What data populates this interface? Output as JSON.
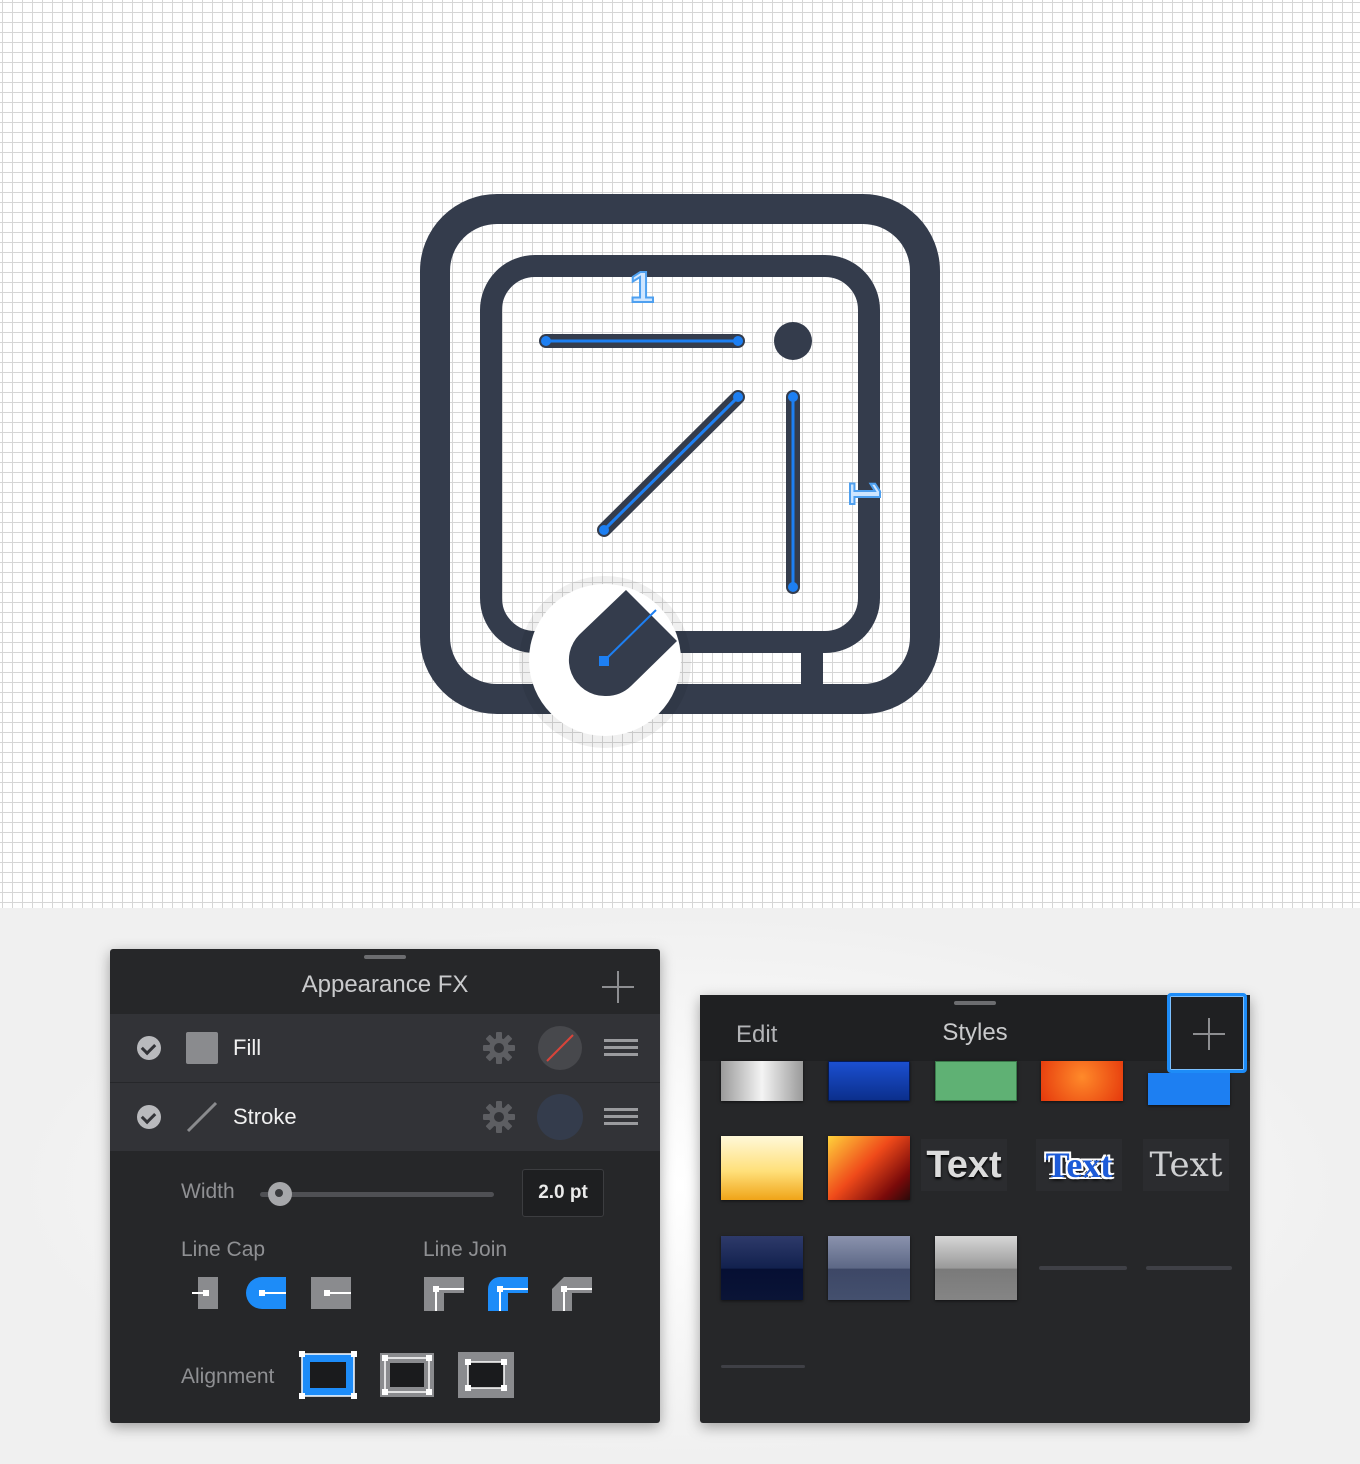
{
  "canvas": {
    "icon_color": "#343c4c",
    "path_highlight_color": "#1d7ff2",
    "measure_label_top": "1",
    "measure_label_side": "1"
  },
  "appearance_panel": {
    "title": "Appearance FX",
    "rows": [
      {
        "label": "Fill",
        "enabled": true,
        "swatch": "none"
      },
      {
        "label": "Stroke",
        "enabled": true,
        "swatch": "#343c4c"
      }
    ],
    "width_label": "Width",
    "width_value": "2.0 pt",
    "line_cap_label": "Line Cap",
    "line_join_label": "Line Join",
    "alignment_label": "Alignment",
    "line_cap_selected": "round",
    "line_join_selected": "round",
    "alignment_selected": "inside",
    "accent": "#1d8cf8"
  },
  "styles_panel": {
    "edit_label": "Edit",
    "title": "Styles",
    "text_styles": [
      "Text",
      "Text",
      "Text"
    ]
  }
}
